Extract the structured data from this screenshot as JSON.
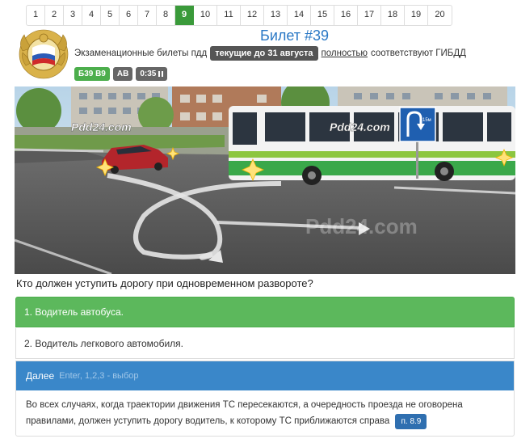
{
  "pagination": [
    "1",
    "2",
    "3",
    "4",
    "5",
    "6",
    "7",
    "8",
    "9",
    "10",
    "11",
    "12",
    "13",
    "14",
    "15",
    "16",
    "17",
    "18",
    "19",
    "20"
  ],
  "active_page": "9",
  "header": {
    "title": "Билет #39",
    "subtitle_prefix": "Экзаменационные билеты пдд",
    "dark_badge": "текущие до 31 августа",
    "link": "полностью",
    "subtitle_suffix": "соответствуют ГИБДД"
  },
  "badges": {
    "ticket": "Б39 В9",
    "category": "АВ",
    "timer": "0:35"
  },
  "scene": {
    "watermark": "Pdd24.com",
    "sign_label": "15м"
  },
  "question": "Кто должен уступить дорогу при одновременном развороте?",
  "answers": [
    {
      "label": "1. Водитель автобуса."
    },
    {
      "label": "2. Водитель легкового автомобиля."
    }
  ],
  "explanation": {
    "next_label": "Далее",
    "hint": "Enter, 1,2,3 - выбор",
    "text": "Во всех случаях, когда траектории движения ТС пересекаются, а очередность проезда не оговорена правилами, должен уступить дорогу водитель, к которому ТС приближаются справа",
    "rule_ref": "п. 8.9"
  },
  "colors": {
    "correct": "#5cb85c",
    "accent_blue": "#3a87c9",
    "title_blue": "#2a78c5",
    "active_page": "#3a9a3a"
  }
}
